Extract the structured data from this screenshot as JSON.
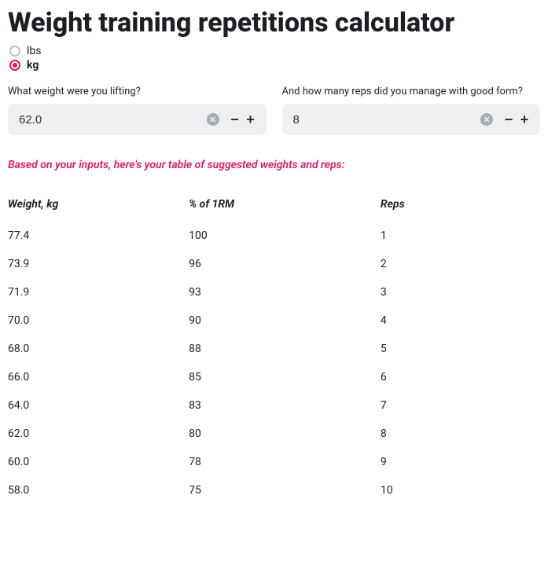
{
  "title": "Weight training repetitions calculator",
  "units": {
    "lbs_label": "lbs",
    "kg_label": "kg",
    "selected": "kg"
  },
  "inputs": {
    "weight_label": "What weight were you lifting?",
    "weight_value": "62.0",
    "reps_label": "And how many reps did you manage with good form?",
    "reps_value": "8"
  },
  "caption": "Based on your inputs, here's your table of suggested weights and reps:",
  "table": {
    "headers": {
      "weight": "Weight, kg",
      "pct": "% of 1RM",
      "reps": "Reps"
    },
    "rows": [
      {
        "weight": "77.4",
        "pct": "100",
        "reps": "1"
      },
      {
        "weight": "73.9",
        "pct": "96",
        "reps": "2"
      },
      {
        "weight": "71.9",
        "pct": "93",
        "reps": "3"
      },
      {
        "weight": "70.0",
        "pct": "90",
        "reps": "4"
      },
      {
        "weight": "68.0",
        "pct": "88",
        "reps": "5"
      },
      {
        "weight": "66.0",
        "pct": "85",
        "reps": "6"
      },
      {
        "weight": "64.0",
        "pct": "83",
        "reps": "7"
      },
      {
        "weight": "62.0",
        "pct": "80",
        "reps": "8"
      },
      {
        "weight": "60.0",
        "pct": "78",
        "reps": "9"
      },
      {
        "weight": "58.0",
        "pct": "75",
        "reps": "10"
      }
    ]
  }
}
